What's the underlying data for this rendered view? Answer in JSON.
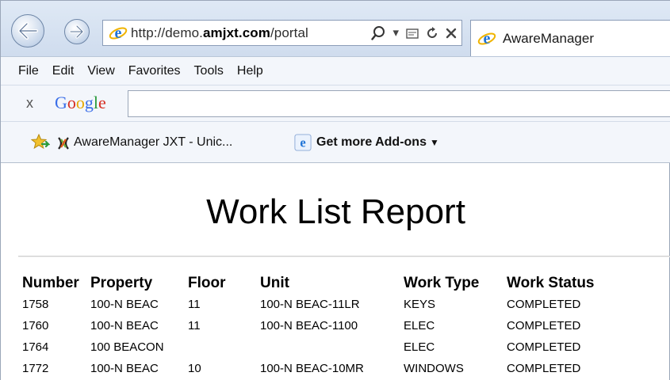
{
  "browser": {
    "url_prefix": "http://demo.",
    "url_domain": "amjxt.com",
    "url_suffix": "/portal",
    "tab_title": "AwareManager"
  },
  "menu": [
    "File",
    "Edit",
    "View",
    "Favorites",
    "Tools",
    "Help"
  ],
  "google_toolbar": {
    "close_label": "x",
    "logo": "Google",
    "search_value": ""
  },
  "favorites": {
    "item1": "AwareManager JXT - Unic...",
    "item2": "Get more Add-ons"
  },
  "report": {
    "title": "Work List Report",
    "columns": [
      "Number",
      "Property",
      "Floor",
      "Unit",
      "Work Type",
      "Work Status"
    ],
    "rows": [
      [
        "1758",
        "100-N BEAC",
        "11",
        "100-N BEAC-11LR",
        "KEYS",
        "COMPLETED"
      ],
      [
        "1760",
        "100-N BEAC",
        "11",
        "100-N BEAC-1100",
        "ELEC",
        "COMPLETED"
      ],
      [
        "1764",
        "100 BEACON",
        "",
        "",
        "ELEC",
        "COMPLETED"
      ],
      [
        "1772",
        "100-N BEAC",
        "10",
        "100-N BEAC-10MR",
        "WINDOWS",
        "COMPLETED"
      ]
    ]
  },
  "colors": {
    "ie_blue": "#1e73d6",
    "google_blue": "#3a6ee8",
    "google_red": "#d62d20",
    "google_yellow": "#e8a800",
    "google_green": "#2a9a3c",
    "star_gold": "#f2c12e"
  },
  "icons": [
    "back-arrow-icon",
    "forward-arrow-icon",
    "ie-logo-icon",
    "search-icon",
    "compatibility-icon",
    "refresh-icon",
    "stop-icon",
    "favorites-star-icon",
    "jxt-logo-icon",
    "dropdown-arrow-icon"
  ]
}
